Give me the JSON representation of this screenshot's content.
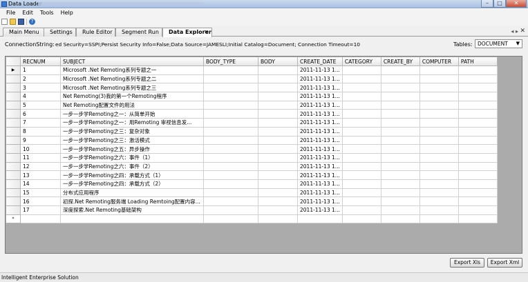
{
  "window": {
    "title": "Data Loader",
    "controls": {
      "minimize": "–",
      "maximize": "□",
      "close": "✕"
    }
  },
  "menu": [
    "File",
    "Edit",
    "Tools",
    "Help"
  ],
  "toolbar": {
    "icons": [
      "new-file-icon",
      "open-folder-icon",
      "save-icon",
      "help-icon"
    ],
    "help_glyph": "?"
  },
  "tabs": [
    {
      "label": "Main Menu",
      "active": false
    },
    {
      "label": "Settings",
      "active": false
    },
    {
      "label": "Rule Editor",
      "active": false
    },
    {
      "label": "Segment Run",
      "active": false
    },
    {
      "label": "Data Explorer",
      "active": true
    }
  ],
  "tab_close": "✕",
  "tab_strip_controls": {
    "arrows": "◂ ▸",
    "close": "✕"
  },
  "connection": {
    "label": "ConnectionString:",
    "value": "ed Security=SSPI;Persist Security Info=False;Data Source=JAMESLI;Initial Catalog=Document; Connection Timeout=10"
  },
  "tables": {
    "label": "Tables:",
    "selected": "DOCUMENT"
  },
  "grid": {
    "columns": [
      "RECNUM",
      "SUBJECT",
      "BODY_TYPE",
      "BODY",
      "CREATE_DATE",
      "CATEGORY",
      "CREATE_BY",
      "COMPUTER",
      "PATH"
    ],
    "current_row_marker": "▶",
    "new_row_marker": "*",
    "rows": [
      [
        "1",
        "Microsoft .Net Remoting系列专题之一",
        "",
        "",
        "2011-11-13 1...",
        "",
        "",
        "",
        ""
      ],
      [
        "2",
        "Microsoft .Net Remoting系列专题之二",
        "",
        "",
        "2011-11-13 1...",
        "",
        "",
        "",
        ""
      ],
      [
        "3",
        "Microsoft .Net Remoting系列专题之三",
        "",
        "",
        "2011-11-13 1...",
        "",
        "",
        "",
        ""
      ],
      [
        "4",
        "Net Remoting(3)我的第一个Remoting程序",
        "",
        "",
        "2011-11-13 1...",
        "",
        "",
        "",
        ""
      ],
      [
        "5",
        "Net Remoting配置文件的用法",
        "",
        "",
        "2011-11-13 1...",
        "",
        "",
        "",
        ""
      ],
      [
        "6",
        "一步一步学Remoting之一：从简单开始",
        "",
        "",
        "2011-11-13 1...",
        "",
        "",
        "",
        ""
      ],
      [
        "7",
        "一步一步学Remoting之一：用Remoting 审视信息发...",
        "",
        "",
        "2011-11-13 1...",
        "",
        "",
        "",
        ""
      ],
      [
        "8",
        "一步一步学Remoting之三：复杂对象",
        "",
        "",
        "2011-11-13 1...",
        "",
        "",
        "",
        ""
      ],
      [
        "9",
        "一步一步学Remoting之三：激活模式",
        "",
        "",
        "2011-11-13 1...",
        "",
        "",
        "",
        ""
      ],
      [
        "10",
        "一步一步学Remoting之五：异步操作",
        "",
        "",
        "2011-11-13 1...",
        "",
        "",
        "",
        ""
      ],
      [
        "11",
        "一步一步学Remoting之六：事件（1）",
        "",
        "",
        "2011-11-13 1...",
        "",
        "",
        "",
        ""
      ],
      [
        "12",
        "一步一步学Remoting之六：事件（2）",
        "",
        "",
        "2011-11-13 1...",
        "",
        "",
        "",
        ""
      ],
      [
        "13",
        "一步一步学Remoting之四：承载方式（1）",
        "",
        "",
        "2011-11-13 1...",
        "",
        "",
        "",
        ""
      ],
      [
        "14",
        "一步一步学Remoting之四：承载方式（2）",
        "",
        "",
        "2011-11-13 1...",
        "",
        "",
        "",
        ""
      ],
      [
        "15",
        "分布式应用程序",
        "",
        "",
        "2011-11-13 1...",
        "",
        "",
        "",
        ""
      ],
      [
        "16",
        "初探.Net Remoting服务端 Loading Remtoing配置内容...",
        "",
        "",
        "2011-11-13 1...",
        "",
        "",
        "",
        ""
      ],
      [
        "17",
        "深度探索.Net Remoting基础架构",
        "",
        "",
        "2011-11-13 1...",
        "",
        "",
        "",
        ""
      ]
    ]
  },
  "buttons": {
    "export_xls": "Export Xls",
    "export_xml": "Export Xml"
  },
  "status": "Intelligent Enterprise Solution"
}
